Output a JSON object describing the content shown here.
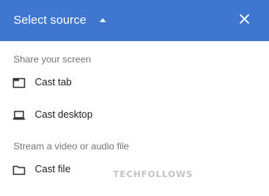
{
  "header": {
    "title": "Select source",
    "caret_icon": "caret-up-icon",
    "close_icon": "close-icon",
    "background": "#3f76cf"
  },
  "sections": [
    {
      "label": "Share your screen",
      "items": [
        {
          "label": "Cast tab",
          "icon": "tab-icon"
        },
        {
          "label": "Cast desktop",
          "icon": "laptop-icon"
        }
      ]
    },
    {
      "label": "Stream a video or audio file",
      "items": [
        {
          "label": "Cast file",
          "icon": "folder-icon"
        }
      ]
    }
  ],
  "watermark": "TECHFOLLOWS"
}
